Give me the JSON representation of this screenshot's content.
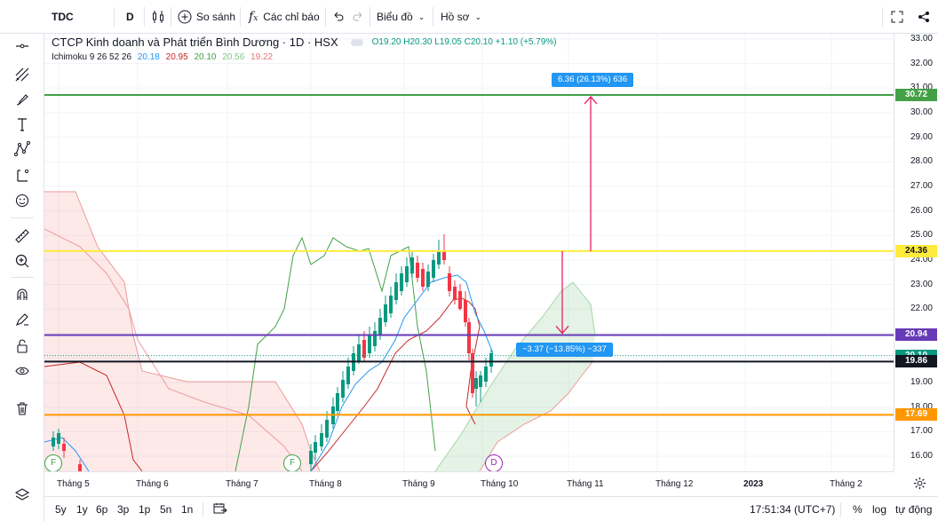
{
  "header": {
    "symbol": "TDC",
    "interval": "D",
    "compare_label": "So sánh",
    "indicators_label": "Các chỉ báo",
    "chart_menu_label": "Biểu đồ",
    "profile_menu_label": "Hồ sơ"
  },
  "legend": {
    "title": "CTCP Kinh doanh và Phát triển Bình Dương · 1D · HSX",
    "open": "O19.20",
    "high": "H20.30",
    "low": "L19.05",
    "close": "C20.10",
    "change": "+1.10 (+5.79%)",
    "indicator_name": "Ichimoku 9 26 52 26",
    "indicator_values": [
      "20.18",
      "20.95",
      "20.10",
      "20.56",
      "19.22"
    ],
    "indicator_colors": [
      "#2196f3",
      "#c62828",
      "#43a047",
      "#a5d6a7",
      "#ef9a9a"
    ]
  },
  "price_axis": {
    "ticks": [
      "33.00",
      "32.00",
      "31.00",
      "30.00",
      "29.00",
      "28.00",
      "27.00",
      "26.00",
      "25.00",
      "24.00",
      "23.00",
      "22.00",
      "21.00",
      "20.00",
      "19.00",
      "18.00",
      "17.00",
      "16.00"
    ],
    "labels": [
      {
        "value": "30.72",
        "color": "#43a047"
      },
      {
        "value": "24.36",
        "color": "#ffeb3b"
      },
      {
        "value": "20.94",
        "color": "#673ab7"
      },
      {
        "value": "20.10",
        "color": "#089981"
      },
      {
        "value": "19.86",
        "color": "#131722"
      },
      {
        "value": "17.69",
        "color": "#ff9800"
      }
    ]
  },
  "time_axis": {
    "ticks": [
      "Tháng 5",
      "Tháng 6",
      "Tháng 7",
      "Tháng 8",
      "Tháng 9",
      "Tháng 10",
      "Tháng 11",
      "Tháng 12",
      "2023",
      "Tháng 2"
    ]
  },
  "measurements": {
    "up": "6.36 (26.13%) 636",
    "down": "−3.37 (−13.85%) −337"
  },
  "events": [
    "F",
    "F",
    "D"
  ],
  "bottom": {
    "ranges": [
      "5y",
      "1y",
      "6p",
      "3p",
      "1p",
      "5n",
      "1n"
    ],
    "time": "17:51:34 (UTC+7)",
    "percent": "%",
    "log": "log",
    "auto": "tự động"
  }
}
